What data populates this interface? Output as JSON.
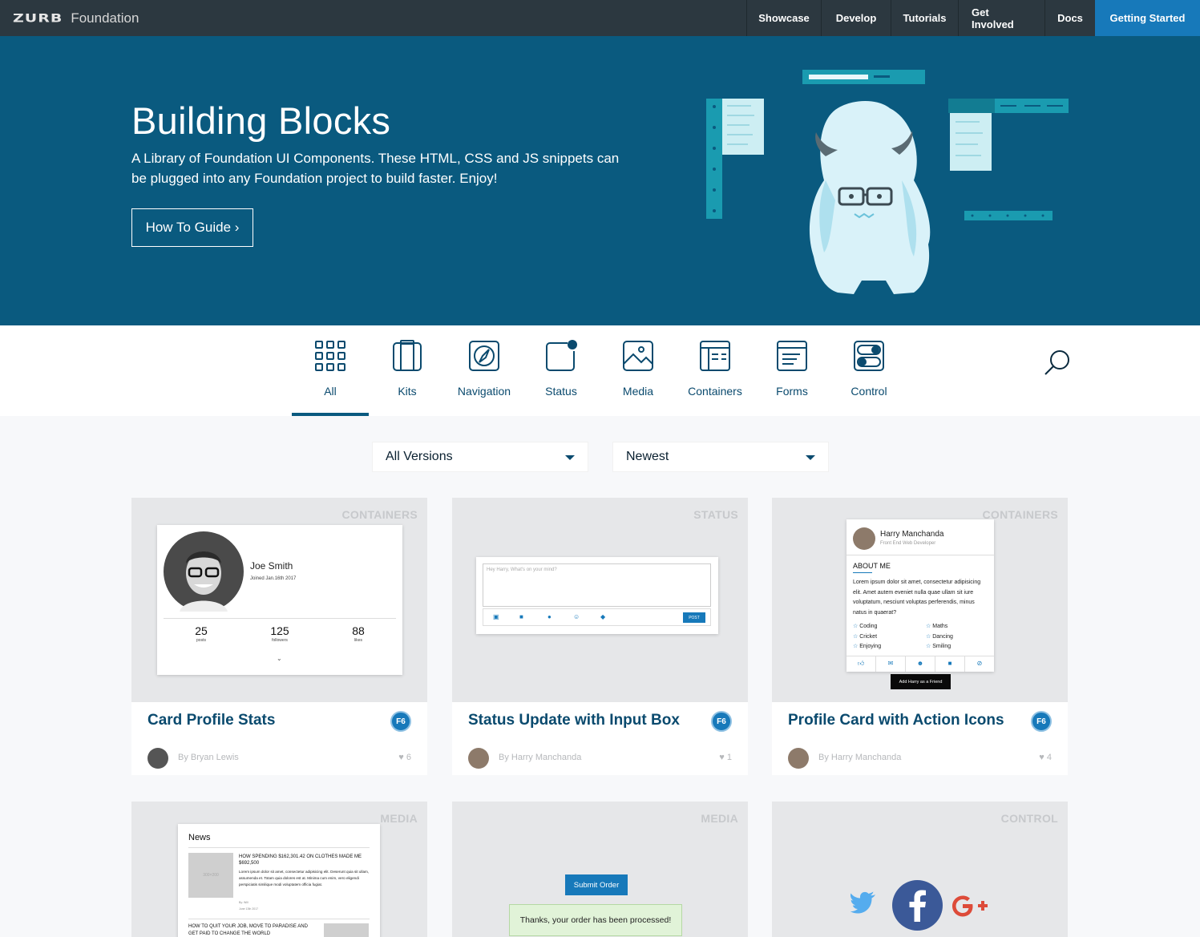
{
  "brand": {
    "logo": "ZURB",
    "name": "Foundation"
  },
  "topnav": [
    "Showcase",
    "Develop",
    "Tutorials",
    "Get Involved",
    "Docs"
  ],
  "topnav_cta": "Getting Started",
  "hero": {
    "title": "Building Blocks",
    "subtitle": "A Library of Foundation UI Components. These HTML, CSS and JS snippets can be plugged into any Foundation project to build faster. Enjoy!",
    "button": "How To Guide ›"
  },
  "categories": [
    {
      "label": "All",
      "icon": "grid-icon"
    },
    {
      "label": "Kits",
      "icon": "kits-icon"
    },
    {
      "label": "Navigation",
      "icon": "compass-icon"
    },
    {
      "label": "Status",
      "icon": "notification-icon"
    },
    {
      "label": "Media",
      "icon": "image-icon"
    },
    {
      "label": "Containers",
      "icon": "containers-icon"
    },
    {
      "label": "Forms",
      "icon": "form-icon"
    },
    {
      "label": "Control",
      "icon": "toggle-icon"
    }
  ],
  "filters": {
    "version": "All Versions",
    "sort": "Newest"
  },
  "cards": [
    {
      "tag": "CONTAINERS",
      "title": "Card Profile Stats",
      "badge": "F6",
      "author": "By Bryan Lewis",
      "likes": "6"
    },
    {
      "tag": "STATUS",
      "title": "Status Update with Input Box",
      "badge": "F6",
      "author": "By Harry Manchanda",
      "likes": "1"
    },
    {
      "tag": "CONTAINERS",
      "title": "Profile Card with Action Icons",
      "badge": "F6",
      "author": "By Harry Manchanda",
      "likes": "4"
    },
    {
      "tag": "MEDIA"
    },
    {
      "tag": "MEDIA"
    },
    {
      "tag": "CONTROL"
    }
  ],
  "previews": {
    "profile_stats": {
      "name": "Joe Smith",
      "joined": "Joined Jan.16th 2017",
      "stats": [
        {
          "value": "25",
          "label": "posts"
        },
        {
          "value": "125",
          "label": "followers"
        },
        {
          "value": "88",
          "label": "likes"
        }
      ]
    },
    "status_update": {
      "placeholder": "Hey Harry, What's on your mind?",
      "post": "POST"
    },
    "profile_card": {
      "name": "Harry Manchanda",
      "role": "Front End Web Developer",
      "about_title": "ABOUT ME",
      "about": "Lorem ipsum dolor sit amet, consectetur adipisicing elit. Amet autem eveniet nulla quae ullam sit iure voluptatum, nesciunt voluptas perferendis, minus natus in quaerat?",
      "interests_left": [
        "Coding",
        "Cricket",
        "Enjoying"
      ],
      "interests_right": [
        "Maths",
        "Dancing",
        "Smiling"
      ],
      "tooltip": "Add Harry as a Friend"
    },
    "news": {
      "title": "News",
      "item1_title": "HOW SPENDING $162,301.42 ON CLOTHES MADE ME $692,500",
      "item1_body": "Lorem ipsum dolor sit amet, consectetur adipisicing elit. Deserunt quia sit ullam, assumenda et. Totam quia dolores est at. Minima cum enim, vero eligendi perspiciatis similique modi voluptatem officia fugiat.",
      "item1_meta": "By: Will",
      "item1_date": "June 13th 2017",
      "item2_title": "HOW TO QUIT YOUR JOB, MOVE TO PARADISE AND GET PAID TO CHANGE THE WORLD",
      "thumb": "300×200"
    },
    "order": {
      "button": "Submit Order",
      "message": "Thanks, your order has been processed!"
    }
  }
}
